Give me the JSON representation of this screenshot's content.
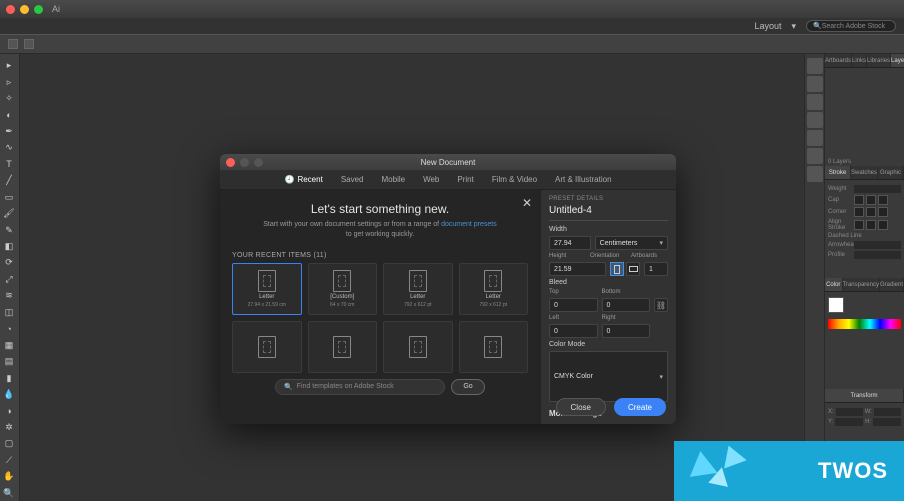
{
  "app_menu": {
    "layout": "Layout",
    "search_placeholder": "Search Adobe Stock"
  },
  "dialog": {
    "title": "New Document",
    "tabs": [
      "Recent",
      "Saved",
      "Mobile",
      "Web",
      "Print",
      "Film & Video",
      "Art & Illustration"
    ],
    "active_tab": "Recent",
    "hero": "Let's start something new.",
    "sub_pre": "Start with your own document settings or from a range of ",
    "sub_link": "document presets",
    "sub_post": " to get working quickly.",
    "recent_head": "YOUR RECENT ITEMS (11)",
    "presets": [
      {
        "name": "Letter",
        "dim": "27.94 x 21.59 cm",
        "sel": true
      },
      {
        "name": "[Custom]",
        "dim": "64 x 70 cm",
        "sel": false
      },
      {
        "name": "Letter",
        "dim": "792 x 612 pt",
        "sel": false
      },
      {
        "name": "Letter",
        "dim": "792 x 612 pt",
        "sel": false
      }
    ],
    "stock_placeholder": "Find templates on Adobe Stock",
    "go": "Go",
    "close_btn": "Close",
    "create_btn": "Create"
  },
  "preset_details": {
    "label": "PRESET DETAILS",
    "name": "Untitled-4",
    "width_lbl": "Width",
    "width": "27.94",
    "units": "Centimeters",
    "height_lbl": "Height",
    "height": "21.59",
    "orient_lbl": "Orientation",
    "artboards_lbl": "Artboards",
    "artboards": "1",
    "bleed_lbl": "Bleed",
    "top_lbl": "Top",
    "bottom_lbl": "Bottom",
    "left_lbl": "Left",
    "right_lbl": "Right",
    "top": "0",
    "bottom": "0",
    "left": "0",
    "right": "0",
    "color_mode_lbl": "Color Mode",
    "color_mode": "CMYK Color",
    "more": "More Settings"
  },
  "right_panels": {
    "top_tabs": [
      "Artboards",
      "Links",
      "Libraries",
      "Layers"
    ],
    "top_active": "Layers",
    "layers_count": "0 Layers",
    "stroke_tabs": [
      "Stroke",
      "Swatches",
      "Graphic Styles"
    ],
    "stroke_active": "Stroke",
    "stroke": {
      "weight": "Weight",
      "cap": "Cap",
      "corner": "Corner",
      "align": "Align Stroke",
      "dashed": "Dashed Line",
      "arrow": "Arrowheads",
      "profile": "Profile"
    },
    "color_tabs": [
      "Color",
      "Transparency",
      "Gradient"
    ],
    "color_active": "Color",
    "transform_tabs": [
      "Transform"
    ],
    "transform": {
      "x": "X:",
      "y": "Y:",
      "w": "W:",
      "h": "H:"
    }
  },
  "watermark": "TWOS"
}
